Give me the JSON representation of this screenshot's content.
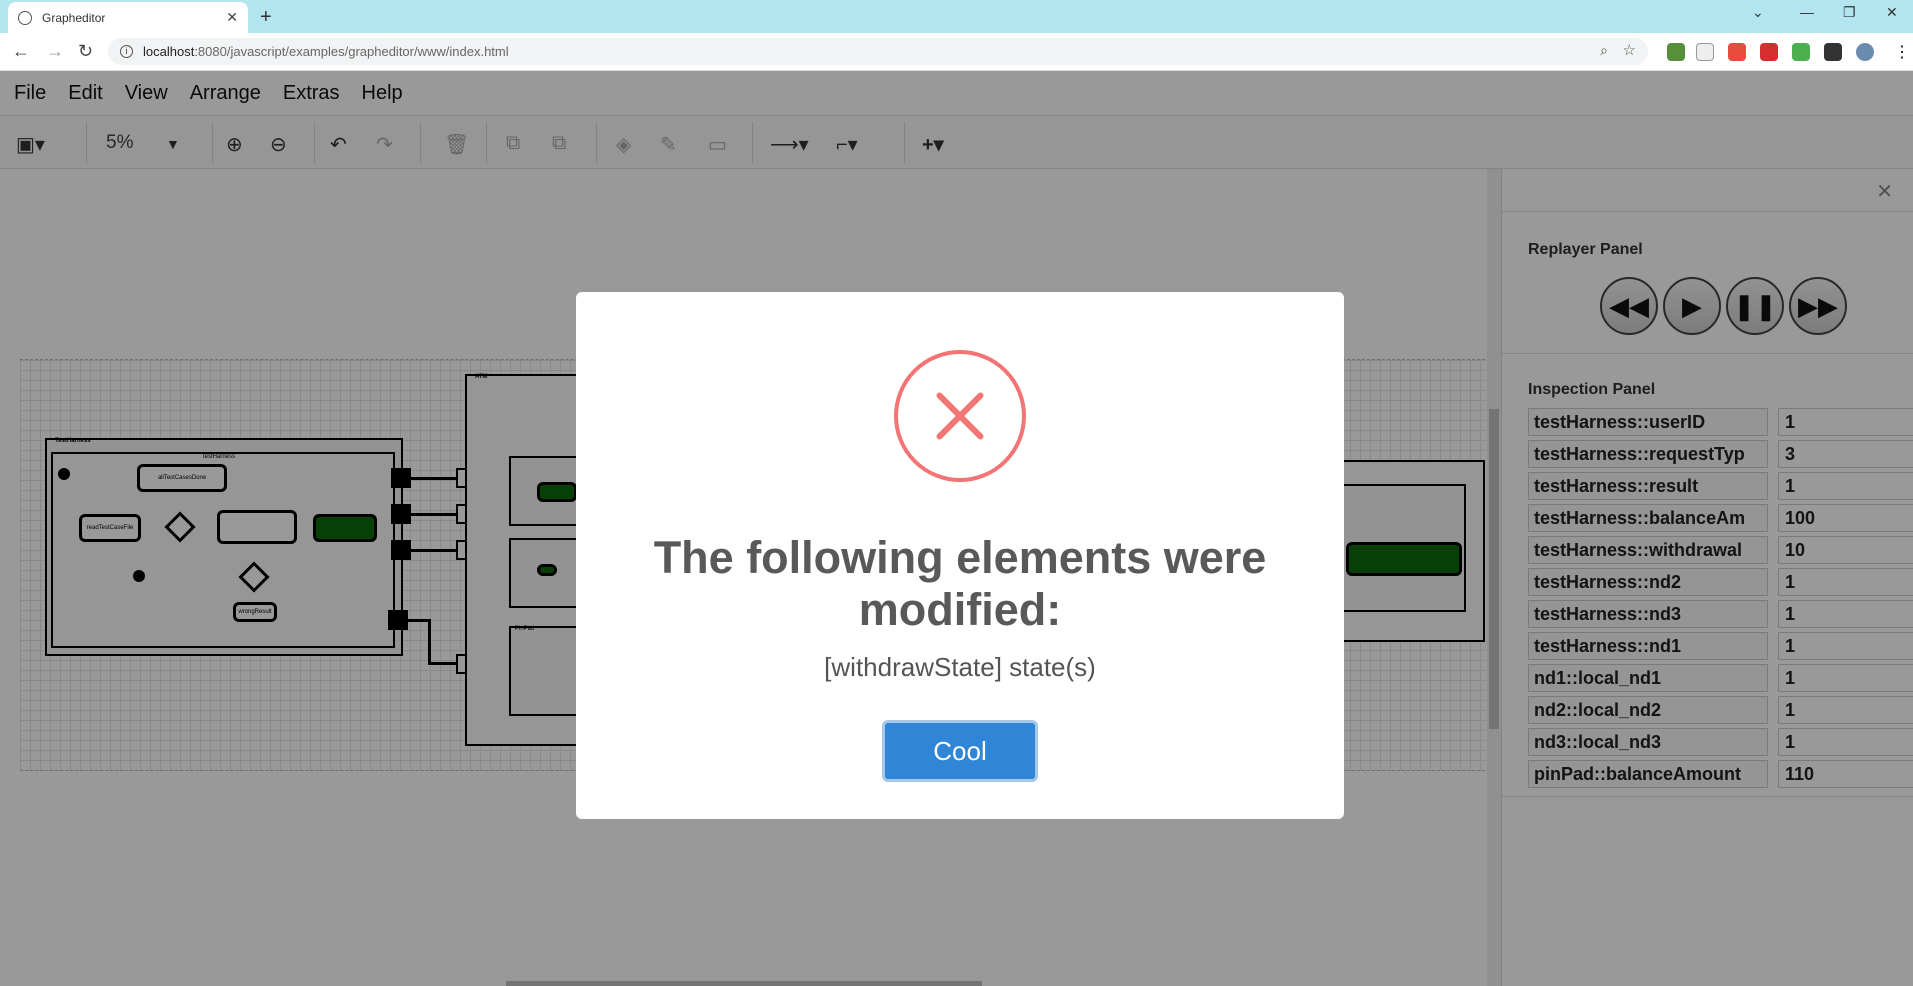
{
  "browser": {
    "tab_title": "Grapheditor",
    "url_host": "localhost",
    "url_path": ":8080/javascript/examples/grapheditor/www/index.html"
  },
  "menu": [
    "File",
    "Edit",
    "View",
    "Arrange",
    "Extras",
    "Help"
  ],
  "toolbar": {
    "zoom": "5%"
  },
  "diagram_labels": {
    "test_harness": "TestHarness",
    "test_harness_inner": "testHarness",
    "atm": "ATM",
    "all_done": "allTestCasesDone",
    "read_file": "readTestCaseFile",
    "wrong_result": "wrongResult",
    "pinpad": "PinPad"
  },
  "replayer": {
    "title": "Replayer Panel",
    "buttons": [
      "rewind",
      "play",
      "pause",
      "fast-forward"
    ]
  },
  "inspection": {
    "title": "Inspection Panel",
    "rows": [
      {
        "key": "testHarness::userID",
        "value": "1"
      },
      {
        "key": "testHarness::requestTyp",
        "value": "3"
      },
      {
        "key": "testHarness::result",
        "value": "1"
      },
      {
        "key": "testHarness::balanceAm",
        "value": "100"
      },
      {
        "key": "testHarness::withdrawal",
        "value": "10"
      },
      {
        "key": "testHarness::nd2",
        "value": "1"
      },
      {
        "key": "testHarness::nd3",
        "value": "1"
      },
      {
        "key": "testHarness::nd1",
        "value": "1"
      },
      {
        "key": "nd1::local_nd1",
        "value": "1"
      },
      {
        "key": "nd2::local_nd2",
        "value": "1"
      },
      {
        "key": "nd3::local_nd3",
        "value": "1"
      },
      {
        "key": "pinPad::balanceAmount",
        "value": "110"
      }
    ]
  },
  "modal": {
    "title": "The following elements were modified:",
    "text": "[withdrawState] state(s)",
    "button": "Cool"
  }
}
